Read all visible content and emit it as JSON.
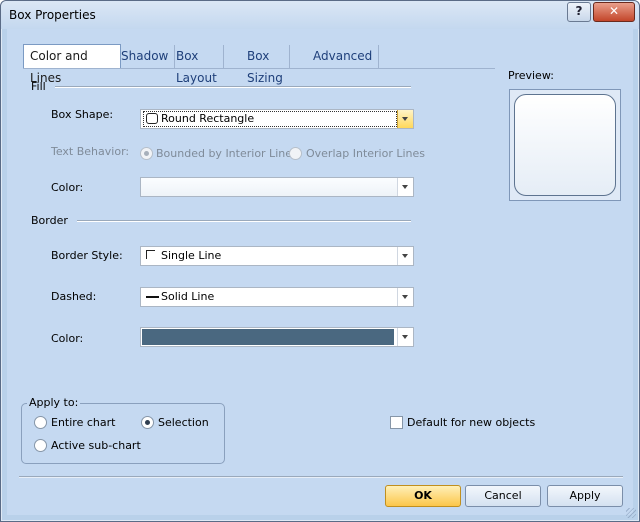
{
  "window": {
    "title": "Box Properties",
    "help": "?",
    "close": "✕"
  },
  "tabs": [
    "Color and Lines",
    "Shadow",
    "Box Layout",
    "Box Sizing",
    "Advanced"
  ],
  "fill": {
    "label": "Fill",
    "box_shape_label": "Box Shape:",
    "box_shape_value": "Round Rectangle",
    "text_behavior_label": "Text Behavior:",
    "text_behavior_options": [
      "Bounded by Interior Lines",
      "Overlap Interior Lines"
    ],
    "text_behavior_selected": "Bounded by Interior Lines",
    "color_label": "Color:",
    "color_value": ""
  },
  "border": {
    "label": "Border",
    "style_label": "Border Style:",
    "style_value": "Single Line",
    "dashed_label": "Dashed:",
    "dashed_value": "Solid Line",
    "color_label": "Color:",
    "color_value": "#4a6880"
  },
  "preview": {
    "label": "Preview:"
  },
  "apply_to": {
    "label": "Apply to:",
    "options": [
      "Entire chart",
      "Selection",
      "Active sub-chart"
    ],
    "selected": "Selection"
  },
  "default_checkbox": {
    "label": "Default for new objects",
    "checked": false
  },
  "buttons": {
    "ok": "OK",
    "cancel": "Cancel",
    "apply": "Apply"
  }
}
